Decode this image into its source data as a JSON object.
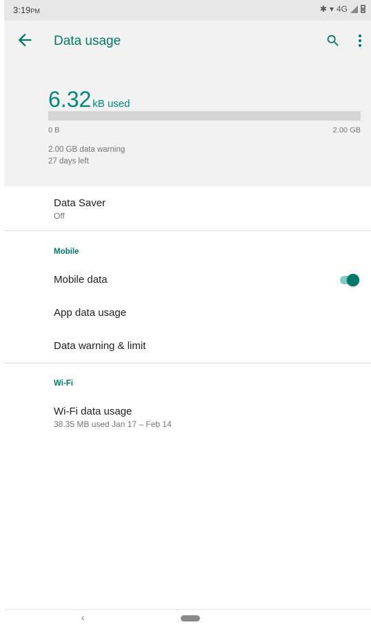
{
  "status": {
    "time": "3:19",
    "ampm": "PM",
    "network": "4G"
  },
  "header": {
    "title": "Data usage"
  },
  "usage": {
    "amount": "6.32",
    "unit": "kB used",
    "fill_fraction": 0.0,
    "min_label": "0 B",
    "max_label": "2.00 GB",
    "warning": "2.00 GB data warning",
    "days_left": "27 days left"
  },
  "data_saver": {
    "title": "Data Saver",
    "value": "Off"
  },
  "mobile": {
    "section_label": "Mobile",
    "mobile_data_label": "Mobile data",
    "mobile_data_on": true,
    "app_data_usage_label": "App data usage",
    "data_warning_label": "Data warning & limit"
  },
  "wifi": {
    "section_label": "Wi-Fi",
    "usage_label": "Wi-Fi data usage",
    "usage_summary": "38.35 MB used Jan 17 – Feb 14"
  },
  "colors": {
    "accent": "#00796b",
    "accent_light": "#80cbc4"
  },
  "icons": [
    "back-arrow-icon",
    "search-icon",
    "more-vert-icon",
    "bluetooth-icon",
    "wifi-icon",
    "signal-icon",
    "battery-icon",
    "nav-back-icon",
    "nav-home-icon"
  ]
}
